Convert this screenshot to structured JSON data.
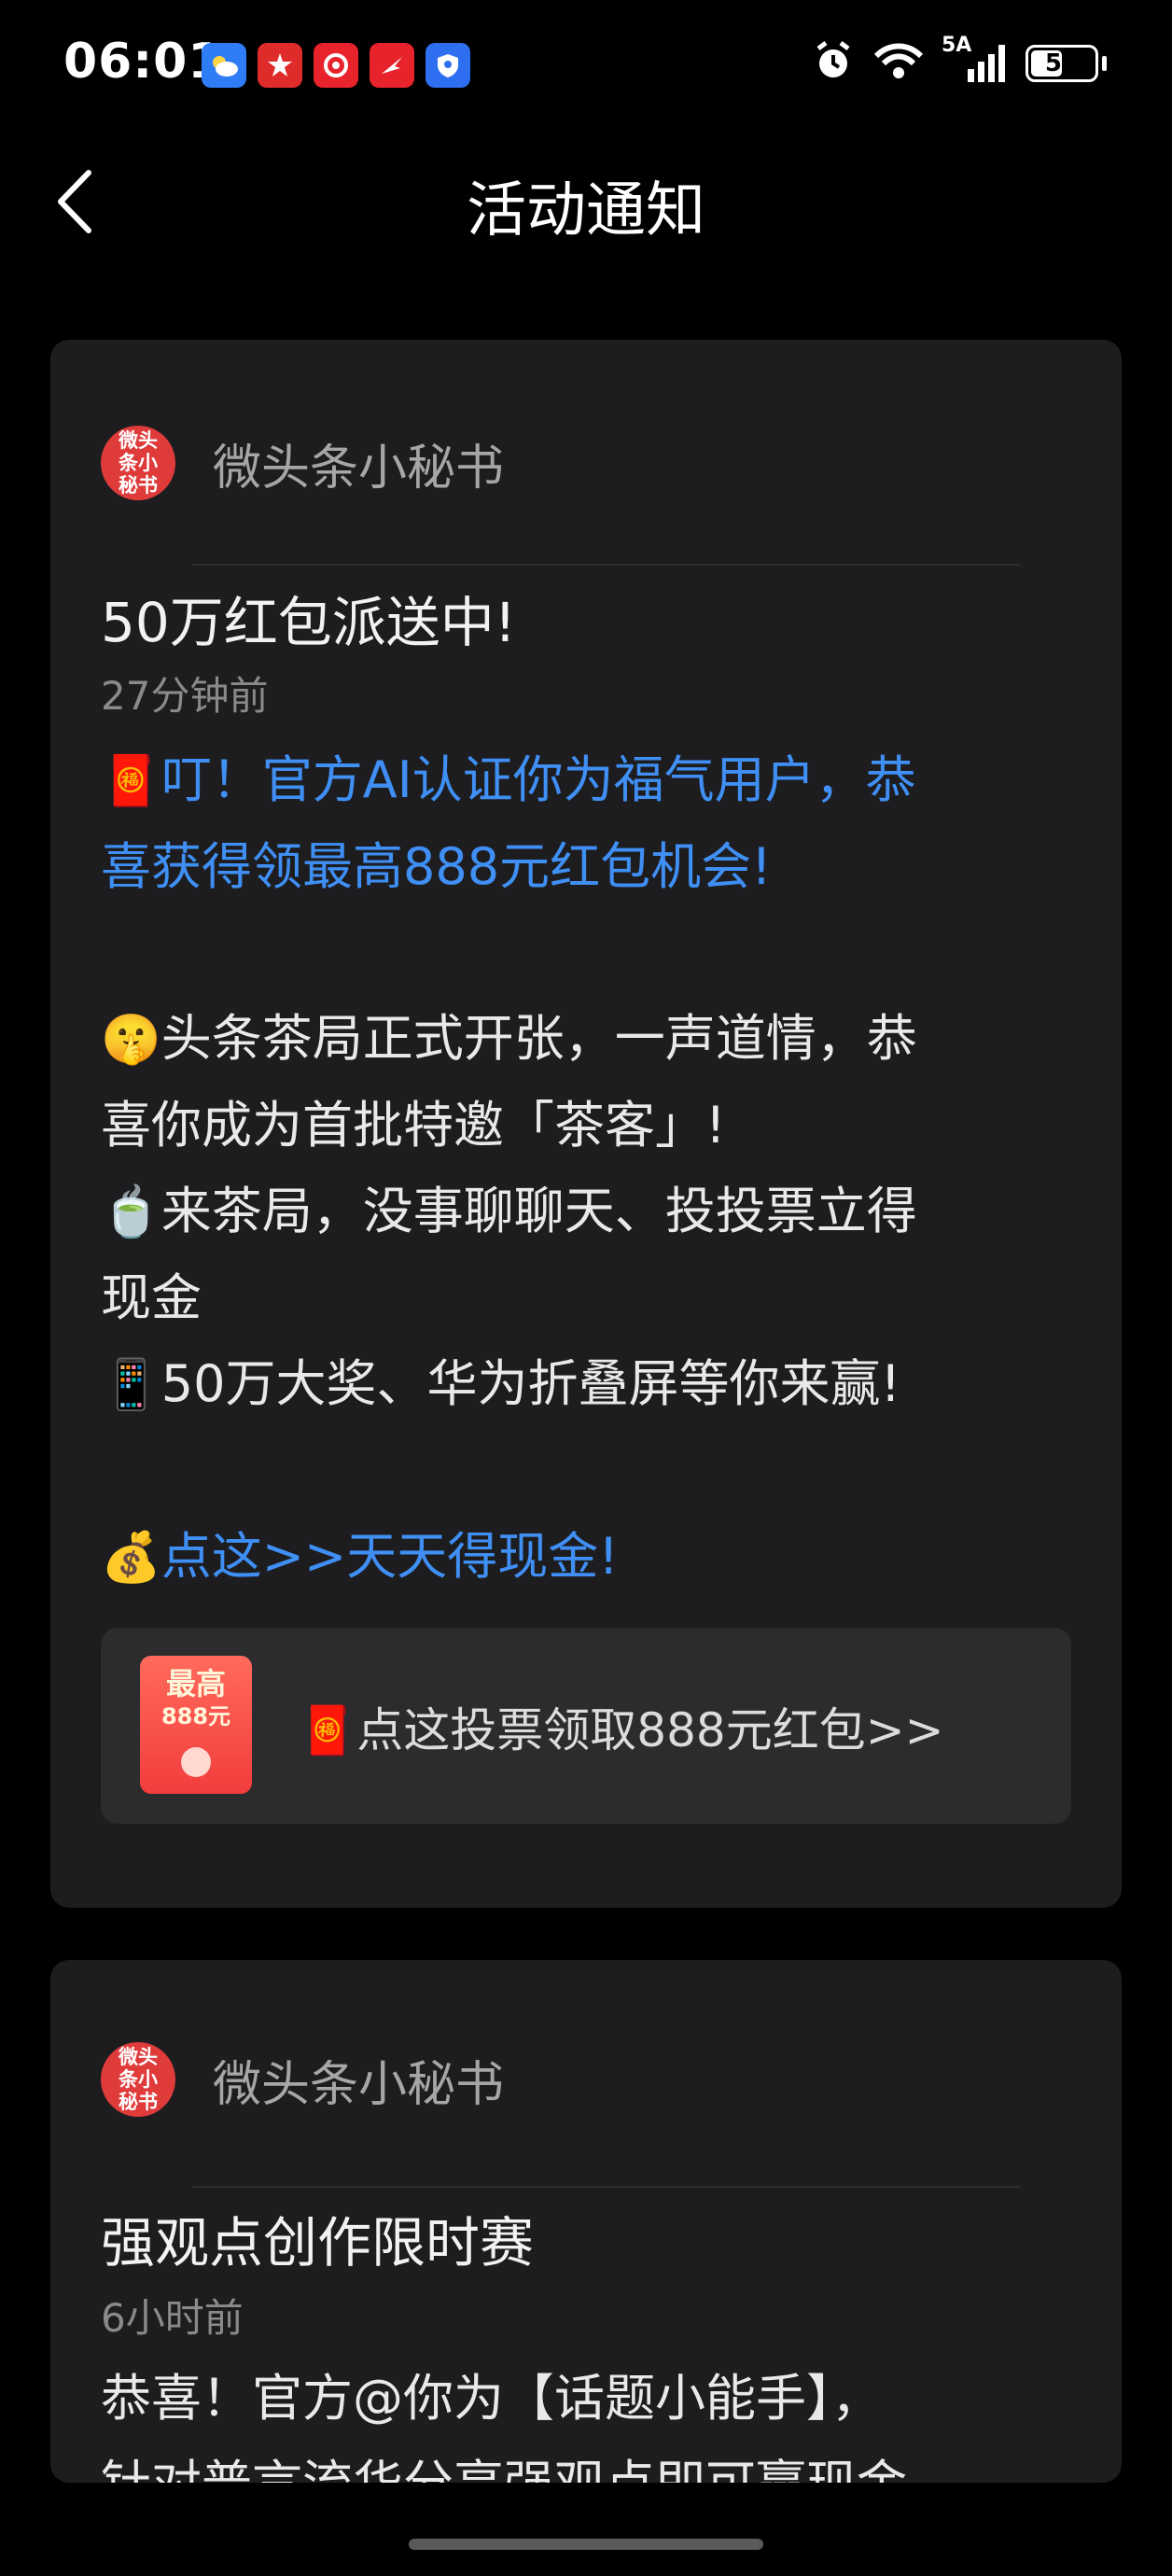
{
  "status_bar": {
    "time": "06:01",
    "network": "5A",
    "battery": "50",
    "battery_level": 0.5,
    "app_icons": [
      "weather-icon",
      "app-red-star-icon",
      "app-news-icon",
      "app-arrow-icon",
      "app-shield-icon"
    ]
  },
  "header": {
    "title": "活动通知"
  },
  "messages": [
    {
      "sender": "微头条小秘书",
      "avatar_text": "微头条小秘书",
      "title": "50万红包派送中!",
      "time": "27分钟前",
      "lines": [
        {
          "emoji": "🧧",
          "text": "叮！官方AI认证你为福气用户，恭",
          "link": true
        },
        {
          "emoji": "",
          "text": "喜获得领最高888元红包机会!",
          "link": true
        },
        {
          "emoji": "🤫",
          "text": "头条茶局正式开张，一声道情，恭",
          "link": false
        },
        {
          "emoji": "",
          "text": "喜你成为首批特邀「茶客」!",
          "link": false
        },
        {
          "emoji": "🍵",
          "text": "来茶局，没事聊聊天、投投票立得",
          "link": false
        },
        {
          "emoji": "",
          "text": "现金",
          "link": false
        },
        {
          "emoji": "📱",
          "text": "50万大奖、华为折叠屏等你来赢!",
          "link": false
        },
        {
          "emoji": "💰",
          "text": "点这>>天天得现金!",
          "link": true
        }
      ],
      "promo": {
        "thumb_line1": "最高",
        "thumb_line2": "888元",
        "emoji": "🧧",
        "text": "点这投票领取888元红包>>"
      }
    },
    {
      "sender": "微头条小秘书",
      "avatar_text": "微头条小秘书",
      "title": "强观点创作限时赛",
      "time": "6小时前",
      "lines": [
        {
          "emoji": "",
          "text": "恭喜！官方@你为【话题小能手】，",
          "link": false
        },
        {
          "emoji": "",
          "text": "针对普言流华分享强观点即可赢现金",
          "link": false
        }
      ]
    }
  ],
  "colors": {
    "background": "#000000",
    "card": "#1d1d1f",
    "link": "#3f8ff5",
    "avatar": "#e03b3b"
  }
}
